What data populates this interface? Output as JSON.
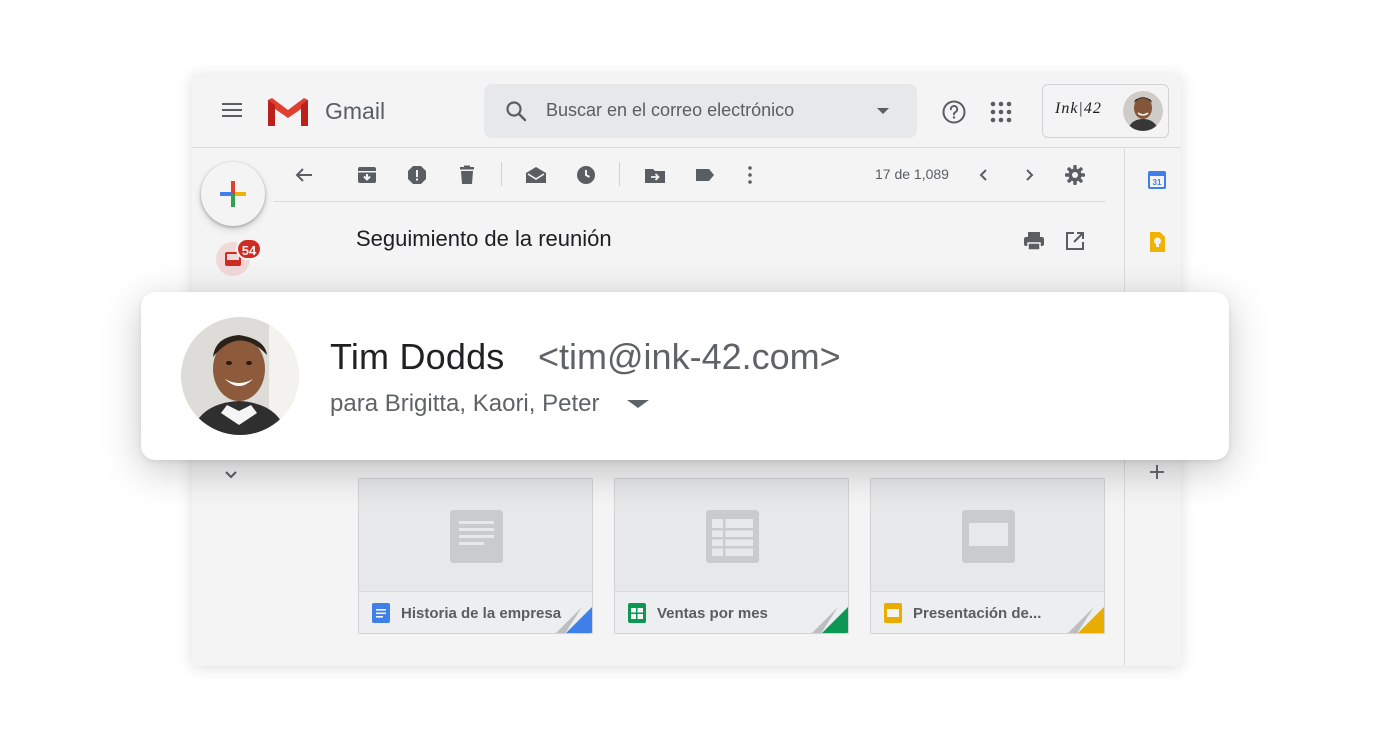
{
  "app": {
    "name": "Gmail",
    "brand_account": "Ink|42"
  },
  "search": {
    "placeholder": "Buscar en el correo electrónico"
  },
  "sidebar": {
    "inbox_badge": "54"
  },
  "toolbar": {
    "icons": [
      "back-arrow-icon",
      "archive-icon",
      "report-spam-icon",
      "delete-icon",
      "mark-unread-icon",
      "snooze-icon",
      "move-to-icon",
      "label-icon",
      "more-vert-icon"
    ],
    "pager": "17 de 1,089"
  },
  "email": {
    "subject": "Seguimiento de la reunión",
    "sender_name": "Tim Dodds",
    "sender_email": "<tim@ink-42.com>",
    "recipients": "para Brigitta, Kaori, Peter"
  },
  "attachments": [
    {
      "name": "Historia de la empresa",
      "type": "docs",
      "color": "#4285f4"
    },
    {
      "name": "Ventas por mes",
      "type": "sheets",
      "color": "#0f9d58"
    },
    {
      "name": "Presentación de...",
      "type": "slides",
      "color": "#f4b400"
    }
  ],
  "right_rail": {
    "calendar_day": "31"
  },
  "colors": {
    "gmail_red": "#ea4335",
    "badge_red": "#d93025",
    "docs_blue": "#4285f4",
    "sheets_green": "#0f9d58",
    "slides_yellow": "#f4b400"
  }
}
